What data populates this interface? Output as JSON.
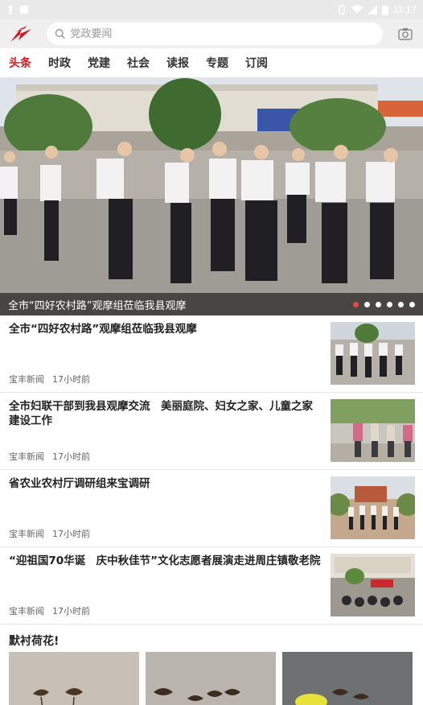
{
  "status_bar": {
    "time": "11:17"
  },
  "header": {
    "search_placeholder": "党政要闻"
  },
  "tabs": [
    {
      "label": "头条",
      "active": true
    },
    {
      "label": "时政"
    },
    {
      "label": "党建"
    },
    {
      "label": "社会"
    },
    {
      "label": "读报"
    },
    {
      "label": "专题"
    },
    {
      "label": "订阅"
    }
  ],
  "hero": {
    "caption": "全市“四好农村路”观摩组莅临我县观摩",
    "slide_count": 6,
    "active_slide": 1
  },
  "news": [
    {
      "title": "全市“四好农村路”观摩组莅临我县观摩",
      "source": "宝丰新闻",
      "time": "17小时前"
    },
    {
      "title": "全市妇联干部到我县观摩交流　美丽庭院、妇女之家、儿童之家建设工作",
      "source": "宝丰新闻",
      "time": "17小时前"
    },
    {
      "title": "省农业农村厅调研组来宝调研",
      "source": "宝丰新闻",
      "time": "17小时前"
    },
    {
      "title": "“迎祖国70华诞　庆中秋佳节”文化志愿者展演走进周庄镇敬老院",
      "source": "宝丰新闻",
      "time": "17小时前"
    }
  ],
  "section": {
    "title": "默衬荷花!"
  },
  "colors": {
    "accent": "#d5161c",
    "active_dot": "#e24a3f"
  }
}
